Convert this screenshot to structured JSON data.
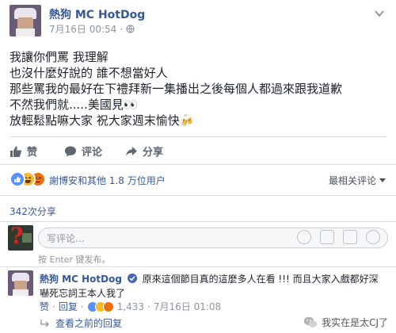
{
  "post": {
    "author": "熱狗 MC HotDog",
    "timestamp": "7月16日 00:54",
    "privacy_icon": "globe-icon",
    "lines": [
      "我讓你們罵 我理解",
      "也沒什麼好說的 誰不想當好人",
      "那些罵我的最好在下禮拜新一集播出之後每個人都過來跟我道歉",
      "不然我們就.....美國見👀",
      "放輕鬆點嘛大家 祝大家週末愉快🍻"
    ]
  },
  "actions": {
    "like": "赞",
    "comment": "评论",
    "share": "分享"
  },
  "reactions": {
    "summary": "謝博安和其他 1.8 万位用户",
    "sort_label": "最相关评论",
    "colors": {
      "like": "#5890ff",
      "haha": "#f7b928",
      "angry": "#e9710f"
    }
  },
  "shares": "342次分享",
  "composer": {
    "placeholder": "写评论...",
    "hint": "按 Enter 键发布。",
    "avatar_glyph": "?"
  },
  "comment": {
    "author": "熱狗 MC HotDog",
    "text": "原來這個節目真的這麼多人在看 !!! 而且大家入戲都好深 嚇死忘詞王本人我了",
    "like": "赞",
    "reply": "回复",
    "count": "1,433",
    "timestamp": "7月16日 01:08",
    "view_replies": "查看之前的回复"
  },
  "watermark": "我实在是太CJ了"
}
